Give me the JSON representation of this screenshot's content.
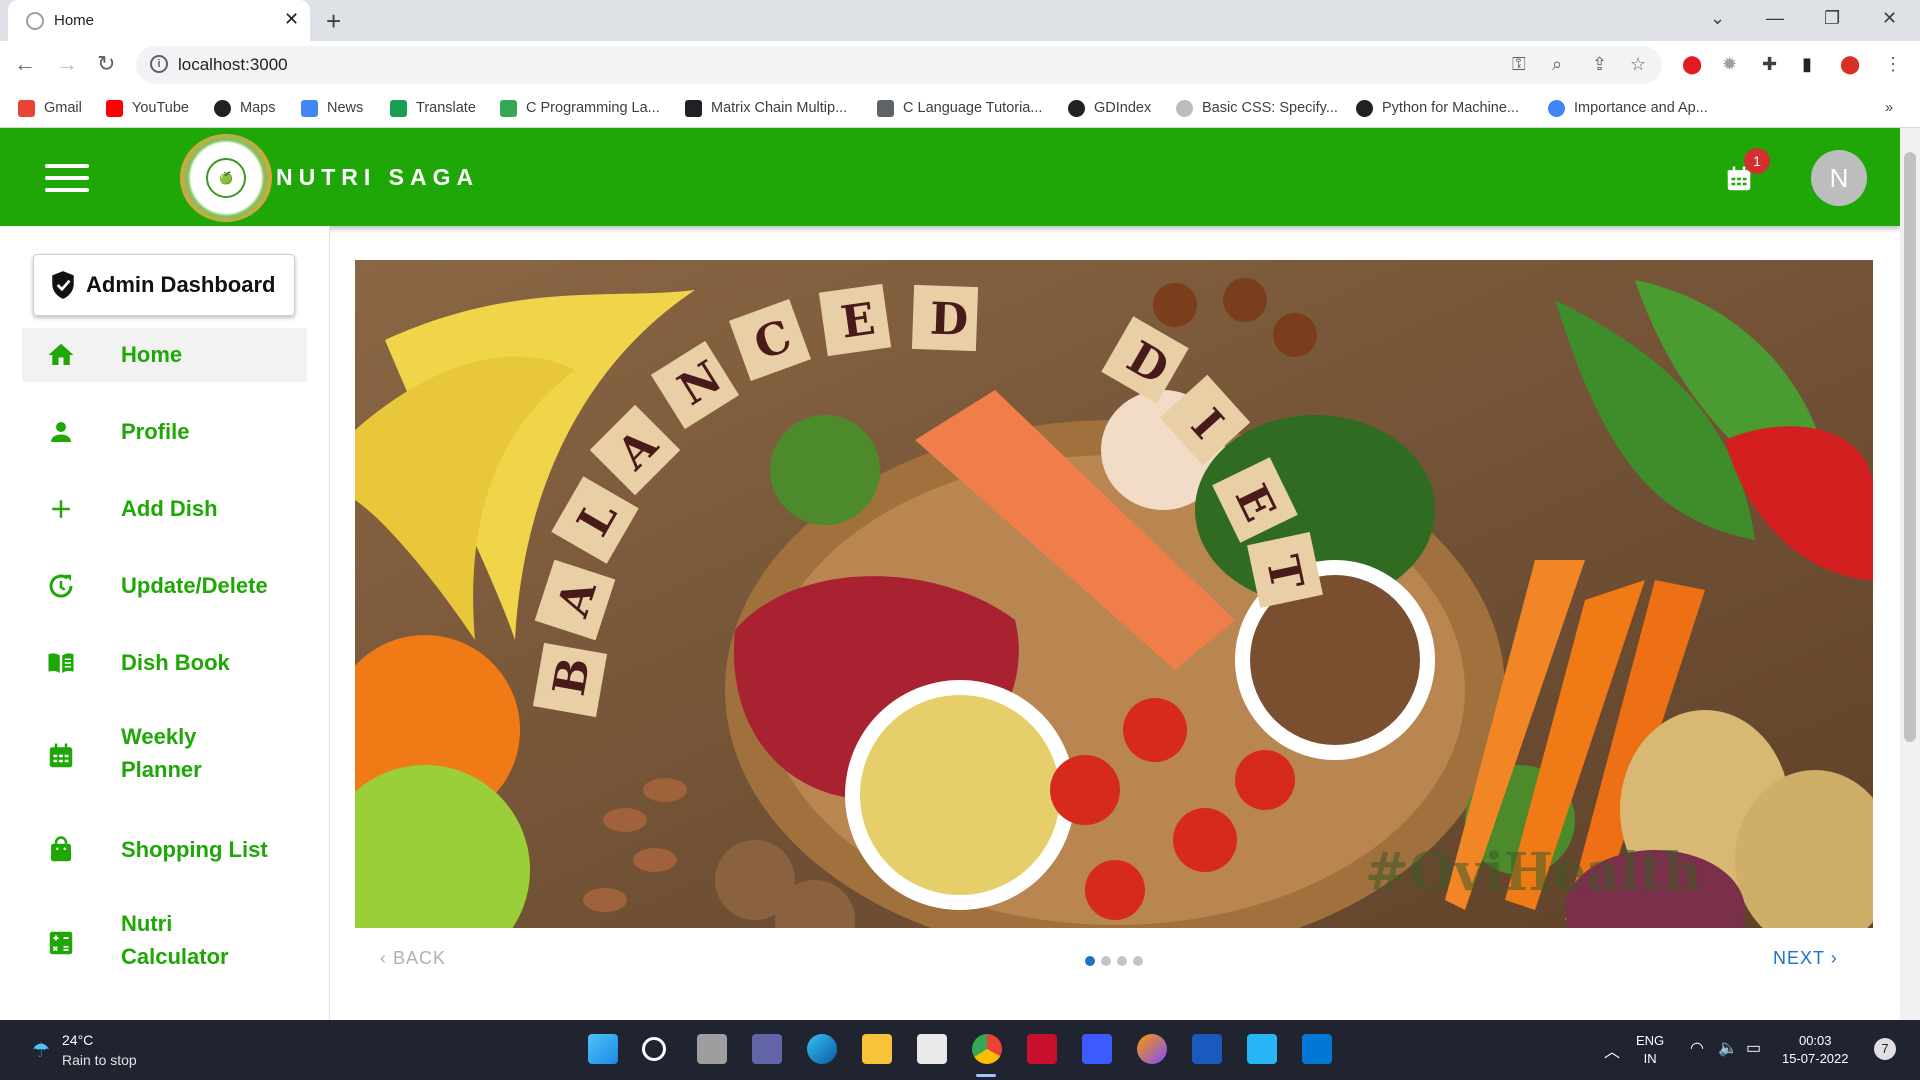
{
  "browser": {
    "tab_title": "Home",
    "tab_close": "✕",
    "new_tab": "+",
    "url": "localhost:3000",
    "window_controls": [
      "⌄",
      "—",
      "❐",
      "✕"
    ],
    "bookmarks": [
      {
        "label": "Gmail",
        "icon": "gmail-icon",
        "color": "#ea4335"
      },
      {
        "label": "YouTube",
        "icon": "youtube-icon",
        "color": "#ff0000"
      },
      {
        "label": "Maps",
        "icon": "maps-icon",
        "color": "#202124"
      },
      {
        "label": "News",
        "icon": "news-icon",
        "color": "#4285f4"
      },
      {
        "label": "Translate",
        "icon": "translate-icon",
        "color": "#1a9e54"
      },
      {
        "label": "C Programming La...",
        "icon": "c-icon",
        "color": "#34a853"
      },
      {
        "label": "Matrix Chain Multip...",
        "icon": "matrix-icon",
        "color": "#202124"
      },
      {
        "label": "C Language Tutoria...",
        "icon": "c-lang-icon",
        "color": "#5f6368"
      },
      {
        "label": "GDIndex",
        "icon": "gdindex-icon",
        "color": "#202124"
      },
      {
        "label": "Basic CSS: Specify...",
        "icon": "fcc-icon",
        "color": "#bdbdbd"
      },
      {
        "label": "Python for Machine...",
        "icon": "github-icon",
        "color": "#202124"
      },
      {
        "label": "Importance and Ap...",
        "icon": "google-icon",
        "color": "#4285f4"
      }
    ],
    "bookmarks_more": "»"
  },
  "app": {
    "brand": "NUTRI SAGA",
    "logo_text": "Nutri Saga",
    "notification_count": "1",
    "avatar_initial": "N",
    "accent_color": "#1ea707"
  },
  "sidebar": {
    "admin_label": "Admin Dashboard",
    "items": [
      {
        "label": "Home",
        "icon": "home-icon"
      },
      {
        "label": "Profile",
        "icon": "person-icon"
      },
      {
        "label": "Add Dish",
        "icon": "plus-icon"
      },
      {
        "label": "Update/Delete",
        "icon": "update-icon"
      },
      {
        "label": "Dish Book",
        "icon": "book-icon"
      },
      {
        "label": "Weekly",
        "label2": "Planner",
        "icon": "calendar-icon"
      },
      {
        "label": "Shopping List",
        "icon": "shopping-bag-icon"
      },
      {
        "label": "Nutri",
        "label2": "Calculator",
        "icon": "calculator-icon"
      }
    ]
  },
  "carousel": {
    "image_text_left": "BALANCED",
    "image_text_right": "DIET",
    "watermark": "#OviHealth",
    "back_label": "BACK",
    "next_label": "NEXT",
    "slide_count": 4,
    "active_slide": 1
  },
  "taskbar": {
    "temperature": "24°C",
    "weather": "Rain to stop",
    "language": "ENG",
    "region": "IN",
    "time": "00:03",
    "date": "15-07-2022",
    "notification_count": "7"
  }
}
